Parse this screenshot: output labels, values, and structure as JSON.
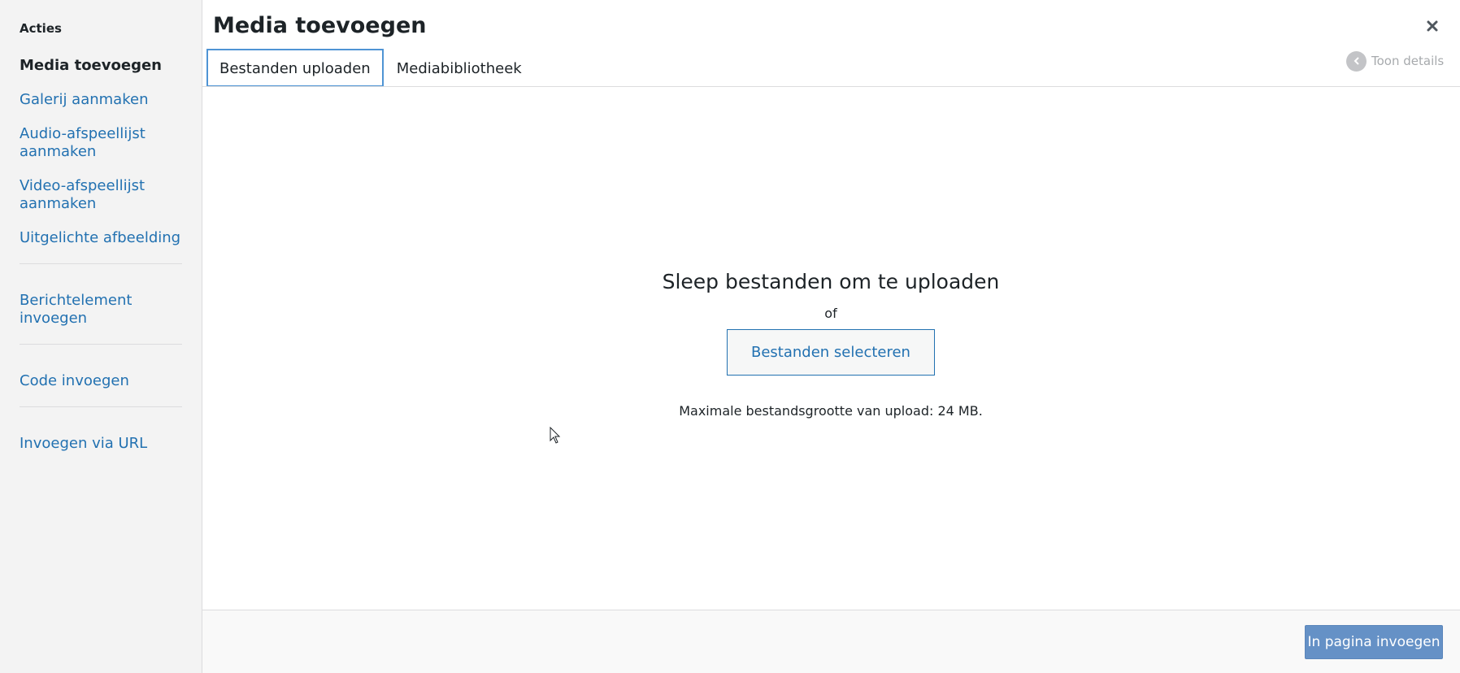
{
  "sidebar": {
    "heading": "Acties",
    "items": [
      {
        "label": "Media toevoegen",
        "active": true
      },
      {
        "label": "Galerij aanmaken"
      },
      {
        "label": "Audio-afspeellijst aanmaken"
      },
      {
        "label": "Video-afspeellijst aanmaken"
      },
      {
        "label": "Uitgelichte afbeelding"
      },
      {
        "label": "Berichtelement invoegen"
      },
      {
        "label": "Code invoegen"
      },
      {
        "label": "Invoegen via URL"
      }
    ]
  },
  "header": {
    "title": "Media toevoegen",
    "close_icon": "close-icon"
  },
  "tabs": [
    {
      "label": "Bestanden uploaden",
      "active": true
    },
    {
      "label": "Mediabibliotheek"
    }
  ],
  "details_toggle": {
    "label": "Toon details",
    "icon": "chevron-left-icon"
  },
  "uploader": {
    "drop_text": "Sleep bestanden om te uploaden",
    "or_text": "of",
    "select_button": "Bestanden selecteren",
    "max_size": "Maximale bestandsgrootte van upload: 24 MB."
  },
  "footer": {
    "insert_button": "In pagina invoegen"
  },
  "colors": {
    "accent": "#2271b1",
    "primary_button": "#6591c6",
    "sidebar_bg": "#f3f3f3"
  }
}
